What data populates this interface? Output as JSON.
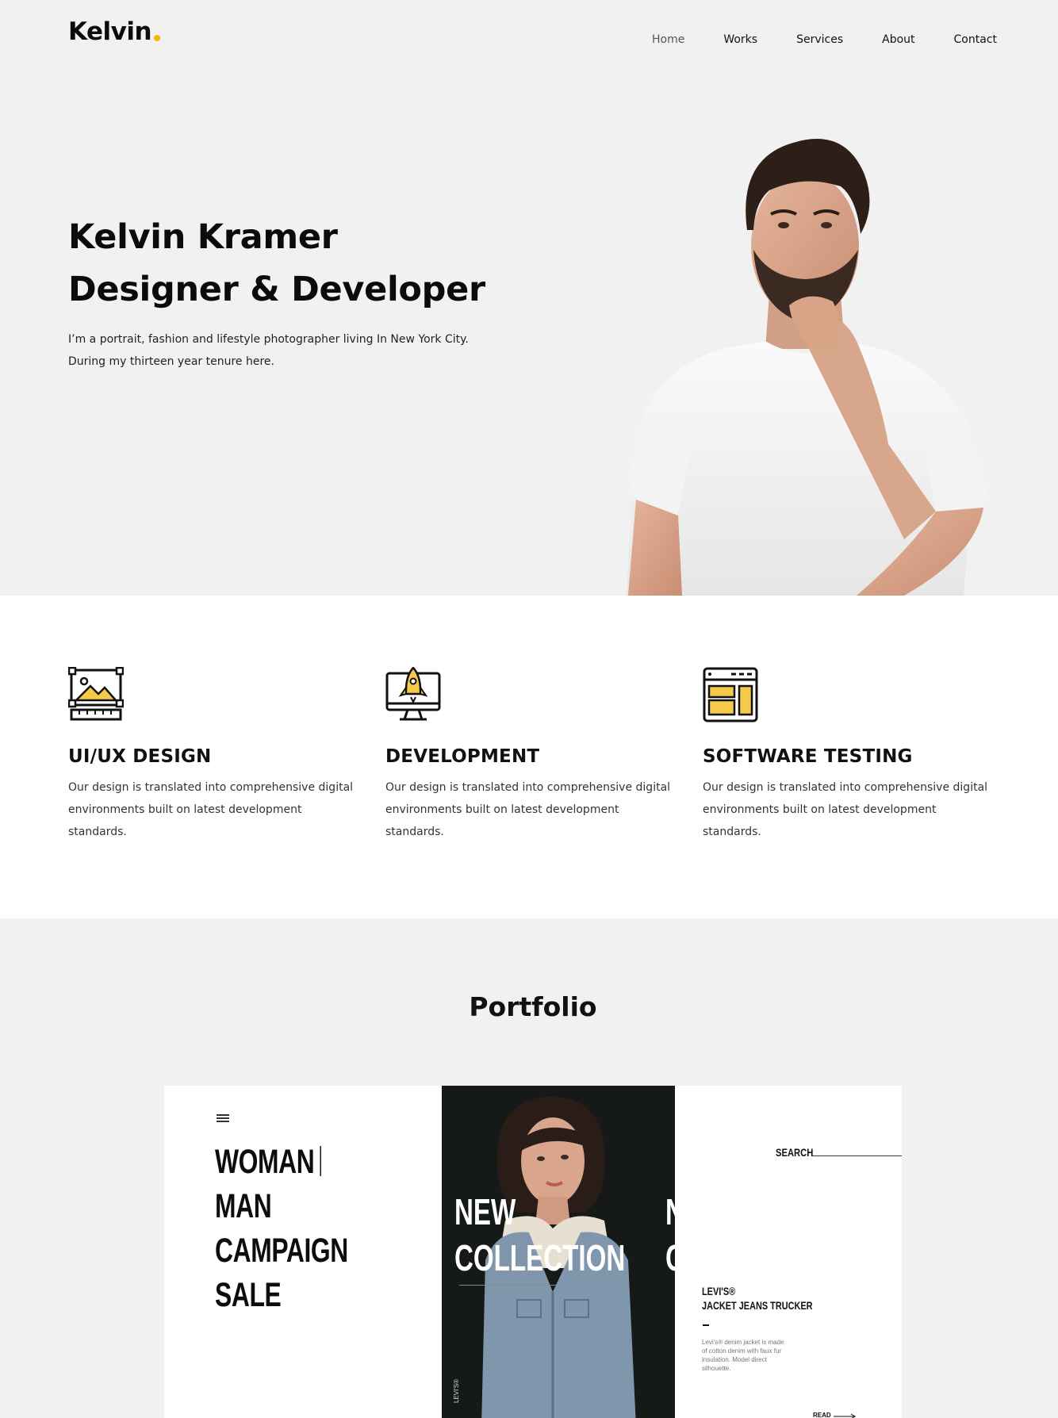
{
  "header": {
    "logo_text": "Kelvin",
    "logo_dot_color": "#f6b500",
    "nav": [
      {
        "label": "Home",
        "active": true
      },
      {
        "label": "Works",
        "active": false
      },
      {
        "label": "Services",
        "active": false
      },
      {
        "label": "About",
        "active": false
      },
      {
        "label": "Contact",
        "active": false
      }
    ]
  },
  "hero": {
    "title_line1": "Kelvin Kramer",
    "title_line2": "Designer & Developer",
    "description_line1": "I’m a portrait, fashion and lifestyle photographer living In New York City.",
    "description_line2": "During my thirteen year tenure here."
  },
  "services": [
    {
      "icon": "image-design-icon",
      "title": "UI/UX DESIGN",
      "text": "Our design is translated into comprehensive digital environments built on latest development standards."
    },
    {
      "icon": "monitor-rocket-icon",
      "title": "DEVELOPMENT",
      "text": "Our design is translated into comprehensive digital environments built on latest development standards."
    },
    {
      "icon": "browser-layout-icon",
      "title": "SOFTWARE TESTING",
      "text": "Our design is translated into comprehensive digital environments built on latest development standards."
    }
  ],
  "accent_color": "#f6c94a",
  "portfolio": {
    "heading": "Portfolio",
    "mockup": {
      "menu": [
        "WOMAN",
        "MAN",
        "CAMPAIGN",
        "SALE"
      ],
      "collection_line1": "NEW",
      "collection_line2": "COLLECTION",
      "ghost_line1": "N",
      "ghost_line2": "C",
      "brand_vertical": "LEVI'S®",
      "search_label": "SEARCH",
      "product_brand": "LEVI'S®",
      "product_name": "JACKET JEANS TRUCKER",
      "product_desc": "Levi's® denim jacket is made of cotton denim with faux fur insulation. Model direct silhouette.",
      "read_label": "READ"
    }
  }
}
